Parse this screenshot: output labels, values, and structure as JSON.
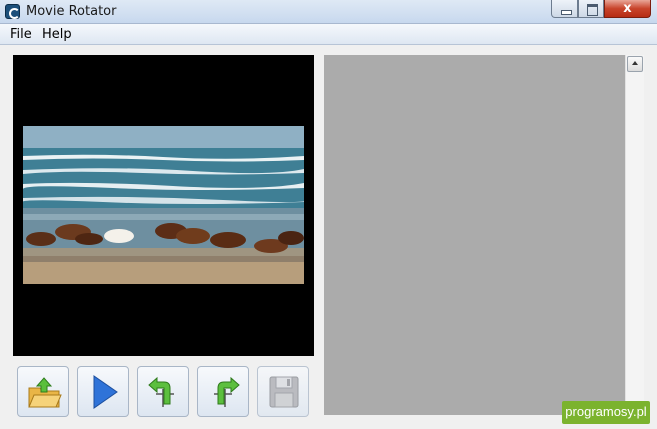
{
  "window": {
    "title": "Movie Rotator",
    "close_glyph": "x"
  },
  "menu": {
    "items": [
      {
        "label": "File"
      },
      {
        "label": "Help"
      }
    ]
  },
  "preview": {
    "description_icon": "video-preview"
  },
  "toolbar": {
    "buttons": [
      {
        "name": "open-file",
        "icon": "folder-open-icon"
      },
      {
        "name": "play",
        "icon": "play-icon"
      },
      {
        "name": "rotate-left",
        "icon": "rotate-left-icon"
      },
      {
        "name": "rotate-right",
        "icon": "rotate-right-icon"
      },
      {
        "name": "save",
        "icon": "floppy-disk-icon",
        "enabled": false
      }
    ]
  },
  "watermark": {
    "text": "programosy.pl"
  },
  "colors": {
    "accent_green": "#7bb32e",
    "play_blue": "#2f73d8",
    "panel_gray": "#ababab"
  }
}
